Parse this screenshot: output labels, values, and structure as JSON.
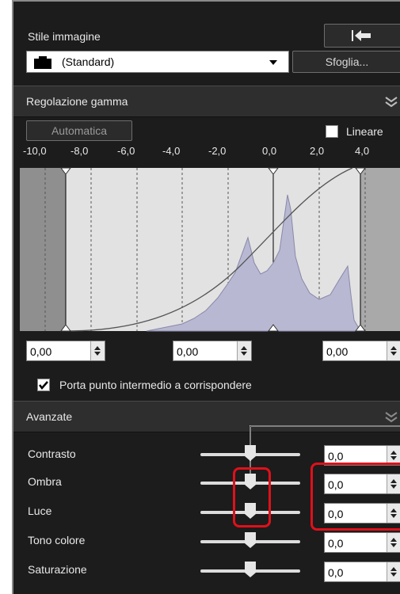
{
  "style": {
    "title": "Stile immagine",
    "preset_value": "(Standard)",
    "browse_label": "Sfoglia..."
  },
  "gamma": {
    "title": "Regolazione gamma",
    "auto_label": "Automatica",
    "linear_label": "Lineare",
    "axis_ticks": [
      "-10,0",
      "-8,0",
      "-6,0",
      "-4,0",
      "-2,0",
      "0,0",
      "2,0",
      "4,0"
    ],
    "fields": [
      "0,00",
      "0,00",
      "0,00"
    ],
    "midpoint_label": "Porta punto intermedio a corrispondere",
    "midpoint_checked": true
  },
  "advanced": {
    "title": "Avanzate",
    "rows": [
      {
        "label": "Contrasto",
        "value": "0,0"
      },
      {
        "label": "Ombra",
        "value": "0,0"
      },
      {
        "label": "Luce",
        "value": "0,0"
      },
      {
        "label": "Tono colore",
        "value": "0,0"
      },
      {
        "label": "Saturazione",
        "value": "0,0"
      }
    ]
  },
  "colors": {
    "panel": "#1c1c1c",
    "highlight": "#e0101a",
    "histogram": "#b8b8d2"
  }
}
